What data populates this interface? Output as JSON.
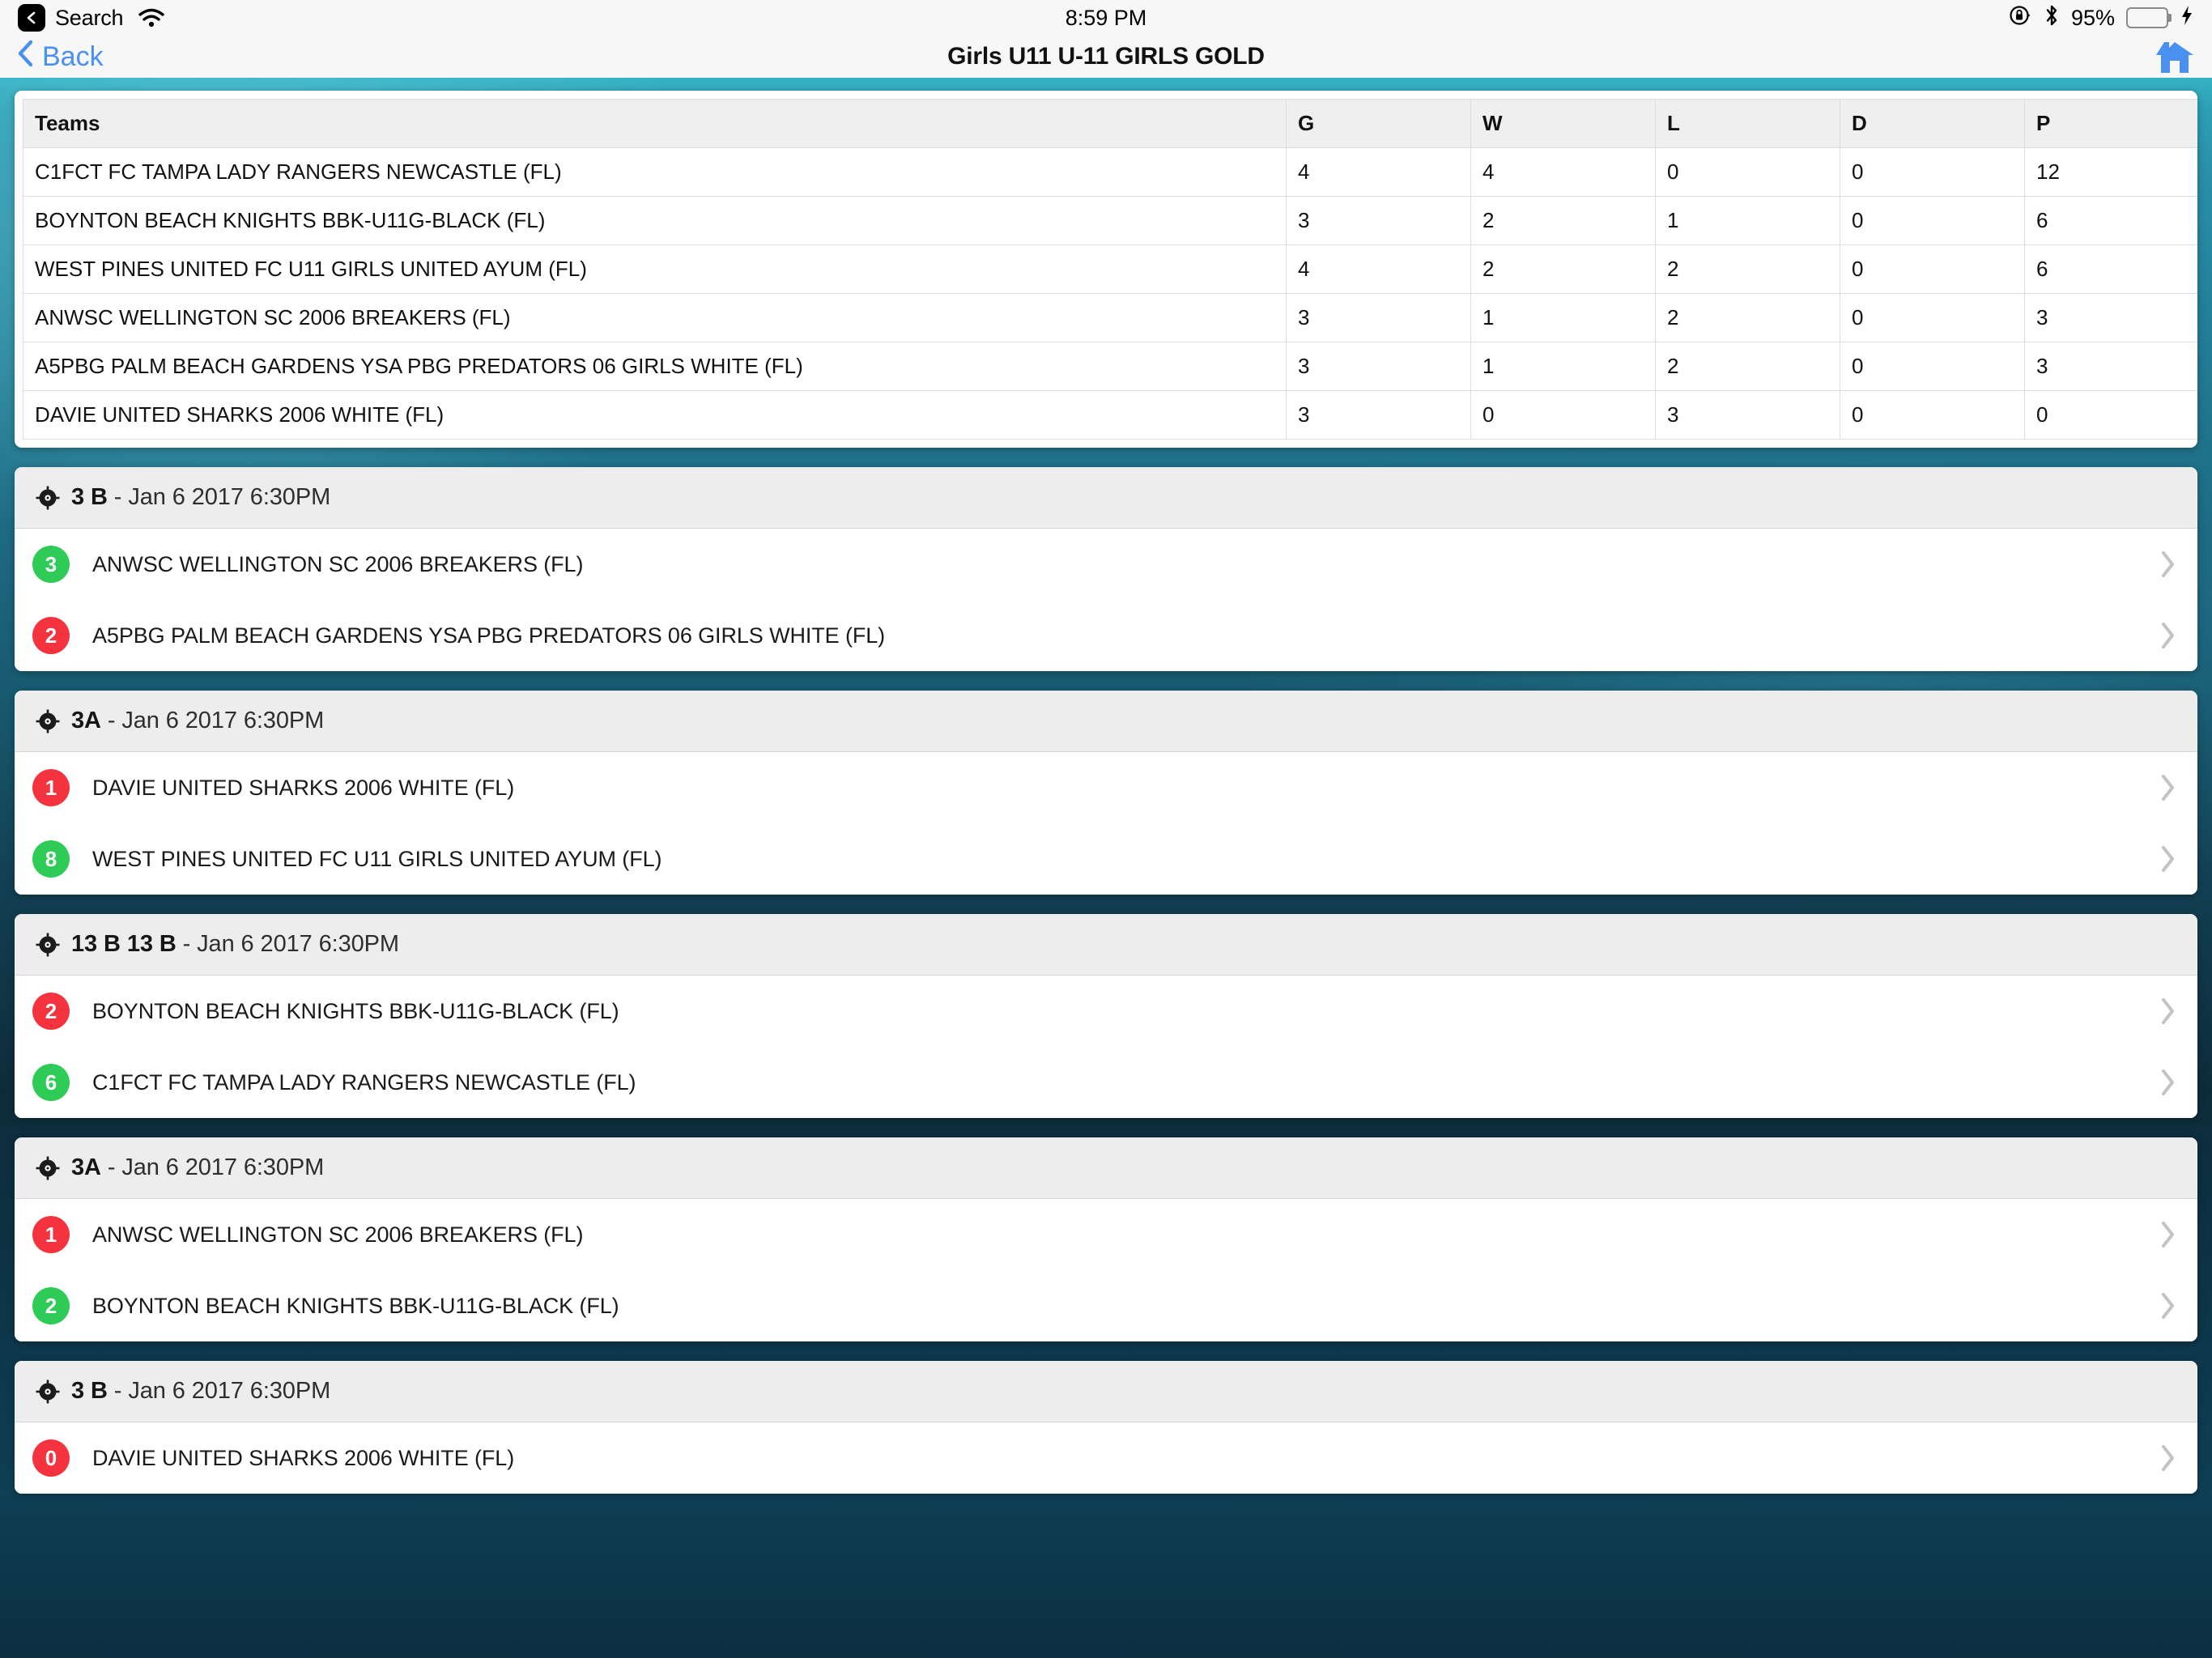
{
  "status_bar": {
    "back_label": "Search",
    "wifi_icon": "wifi-icon",
    "time": "8:59 PM",
    "rotation_lock_icon": "rotation-lock-icon",
    "bluetooth_icon": "bluetooth-icon",
    "battery_percent": "95%",
    "charging_icon": "lightning-bolt-icon",
    "battery_level": 95
  },
  "nav": {
    "back_label": "Back",
    "title": "Girls U11 U-11 GIRLS GOLD",
    "home_icon": "home-icon"
  },
  "colors": {
    "accent_blue": "#4a90f0",
    "win_green": "#2ecc56",
    "lose_red": "#f5333f",
    "backdrop_teal": "#2a8fa8",
    "header_gray": "#ededed"
  },
  "standings": {
    "columns": [
      "Teams",
      "G",
      "W",
      "L",
      "D",
      "P"
    ],
    "rows": [
      {
        "team": "C1FCT FC TAMPA LADY RANGERS NEWCASTLE (FL)",
        "G": "4",
        "W": "4",
        "L": "0",
        "D": "0",
        "P": "12"
      },
      {
        "team": "BOYNTON BEACH KNIGHTS BBK-U11G-BLACK (FL)",
        "G": "3",
        "W": "2",
        "L": "1",
        "D": "0",
        "P": "6"
      },
      {
        "team": "WEST PINES UNITED FC U11 GIRLS UNITED AYUM (FL)",
        "G": "4",
        "W": "2",
        "L": "2",
        "D": "0",
        "P": "6"
      },
      {
        "team": "ANWSC WELLINGTON SC 2006 BREAKERS (FL)",
        "G": "3",
        "W": "1",
        "L": "2",
        "D": "0",
        "P": "3"
      },
      {
        "team": "A5PBG PALM BEACH GARDENS YSA PBG PREDATORS 06 GIRLS WHITE (FL)",
        "G": "3",
        "W": "1",
        "L": "2",
        "D": "0",
        "P": "3"
      },
      {
        "team": "DAVIE UNITED SHARKS 2006 WHITE (FL)",
        "G": "3",
        "W": "0",
        "L": "3",
        "D": "0",
        "P": "0"
      }
    ]
  },
  "matches": [
    {
      "field": "3 B",
      "separator": " - ",
      "datetime": "Jan 6 2017 6:30PM",
      "icon": "soccer-ball-icon",
      "teams": [
        {
          "score": "3",
          "result": "win",
          "name": "ANWSC WELLINGTON SC 2006 BREAKERS (FL)"
        },
        {
          "score": "2",
          "result": "lose",
          "name": "A5PBG PALM BEACH GARDENS YSA PBG PREDATORS 06 GIRLS WHITE (FL)"
        }
      ]
    },
    {
      "field": "3A",
      "separator": " - ",
      "datetime": "Jan 6 2017 6:30PM",
      "icon": "soccer-ball-icon",
      "teams": [
        {
          "score": "1",
          "result": "lose",
          "name": "DAVIE UNITED SHARKS 2006 WHITE (FL)"
        },
        {
          "score": "8",
          "result": "win",
          "name": "WEST PINES UNITED FC U11 GIRLS UNITED AYUM (FL)"
        }
      ]
    },
    {
      "field": "13 B 13 B",
      "separator": " - ",
      "datetime": "Jan 6 2017 6:30PM",
      "icon": "soccer-ball-icon",
      "teams": [
        {
          "score": "2",
          "result": "lose",
          "name": "BOYNTON BEACH KNIGHTS BBK-U11G-BLACK (FL)"
        },
        {
          "score": "6",
          "result": "win",
          "name": "C1FCT FC TAMPA LADY RANGERS NEWCASTLE (FL)"
        }
      ]
    },
    {
      "field": "3A",
      "separator": " - ",
      "datetime": "Jan 6 2017 6:30PM",
      "icon": "soccer-ball-icon",
      "teams": [
        {
          "score": "1",
          "result": "lose",
          "name": "ANWSC WELLINGTON SC 2006 BREAKERS (FL)"
        },
        {
          "score": "2",
          "result": "win",
          "name": "BOYNTON BEACH KNIGHTS BBK-U11G-BLACK (FL)"
        }
      ]
    },
    {
      "field": "3 B",
      "separator": " - ",
      "datetime": "Jan 6 2017 6:30PM",
      "icon": "soccer-ball-icon",
      "teams": [
        {
          "score": "0",
          "result": "lose",
          "name": "DAVIE UNITED SHARKS 2006 WHITE (FL)"
        }
      ]
    }
  ]
}
